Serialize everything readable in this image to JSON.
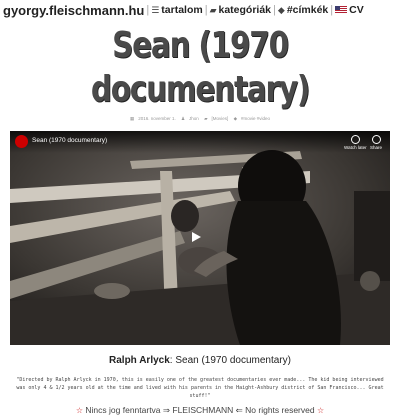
{
  "nav": {
    "site_title": "gyorgy.fleischmann.hu",
    "items": [
      {
        "label": "tartalom",
        "icon": "list-icon"
      },
      {
        "label": "kategóriák",
        "icon": "folder-icon"
      },
      {
        "label": "#címkék",
        "icon": "tag-icon"
      },
      {
        "label": "CV",
        "icon": "us-flag-icon"
      }
    ]
  },
  "post": {
    "title": "Sean (1970 documentary)",
    "meta": {
      "date": "2016. november 1.",
      "author": "Jhon",
      "category": "[Movies]",
      "tags": "#movie #video"
    }
  },
  "video": {
    "title": "Sean (1970 documentary)",
    "watch_later": "Watch later",
    "share": "Share"
  },
  "caption": {
    "author": "Ralph Arlyck",
    "rest": ": Sean (1970 documentary)"
  },
  "quote": "\"Directed by Ralph Arlyck in 1970, this is easily one of the greatest documentaries ever made... The kid being interviewed was only 4 & 1/2 years old at the time and lived with his parents in the Haight-Ashbury district of San Francisco... Great stuff!\"",
  "footer": {
    "text": "Nincs jog fenntartva ⇒ FLEISCHMANN ⇐ No rights reserved"
  },
  "colors": {
    "title": "#4a4a4a",
    "star": "#cc2222",
    "youtube_red": "#cc0000"
  }
}
